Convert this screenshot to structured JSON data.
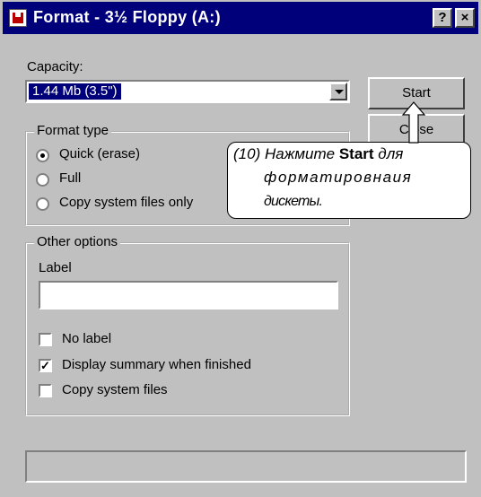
{
  "window": {
    "title": "Format - 3½ Floppy (A:)",
    "help_button": "?",
    "close_button": "×"
  },
  "capacity": {
    "label": "Capacity:",
    "selected": "1.44 Mb (3.5\")"
  },
  "buttons": {
    "start": "Start",
    "close": "Close"
  },
  "format_type": {
    "title": "Format type",
    "options": [
      {
        "label": "Quick (erase)",
        "selected": true
      },
      {
        "label": "Full",
        "selected": false
      },
      {
        "label": "Copy system files only",
        "selected": false
      }
    ]
  },
  "other_options": {
    "title": "Other options",
    "label_caption": "Label",
    "label_value": "",
    "checkboxes": [
      {
        "label": "No label",
        "checked": false
      },
      {
        "label": "Display summary when finished",
        "checked": true
      },
      {
        "label": "Copy system files",
        "checked": false
      }
    ]
  },
  "callout": {
    "prefix": "(10) Нажмите ",
    "emphasis": "Start",
    "suffix": " для",
    "line2": "форматировнаия",
    "line3": "дискеты."
  },
  "icons": [
    "floppy-format-icon",
    "help-icon",
    "close-icon",
    "chevron-down-icon",
    "pointer-arrow-icon"
  ]
}
